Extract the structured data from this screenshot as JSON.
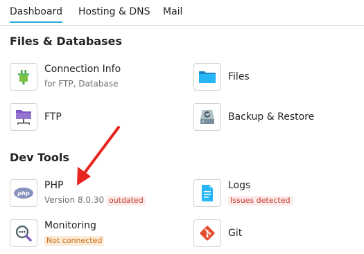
{
  "tabs": [
    {
      "label": "Dashboard",
      "active": true
    },
    {
      "label": "Hosting & DNS",
      "active": false
    },
    {
      "label": "Mail",
      "active": false
    }
  ],
  "sections": {
    "files": {
      "title": "Files & Databases",
      "items": {
        "connection_info": {
          "label": "Connection Info",
          "sub": "for FTP, Database",
          "icon": "plug-icon"
        },
        "files": {
          "label": "Files",
          "icon": "folder-icon"
        },
        "ftp": {
          "label": "FTP",
          "icon": "ftp-folder-icon"
        },
        "backup": {
          "label": "Backup & Restore",
          "icon": "backup-drive-icon"
        }
      }
    },
    "dev": {
      "title": "Dev Tools",
      "items": {
        "php": {
          "label": "PHP",
          "sub": "Version 8.0.30",
          "badge": "outdated",
          "icon": "php-icon"
        },
        "logs": {
          "label": "Logs",
          "badge": "Issues detected",
          "icon": "logs-file-icon"
        },
        "monitoring": {
          "label": "Monitoring",
          "badge": "Not connected",
          "icon": "monitoring-magnifier-icon"
        },
        "git": {
          "label": "Git",
          "icon": "git-icon"
        }
      }
    }
  },
  "colors": {
    "tab_accent": "#28aade",
    "badge_red_bg": "#fdeaea",
    "badge_red_text": "#c0392b",
    "badge_orange_bg": "#fdebd7",
    "badge_orange_text": "#c26a13",
    "annotation_arrow": "#e8231e"
  }
}
